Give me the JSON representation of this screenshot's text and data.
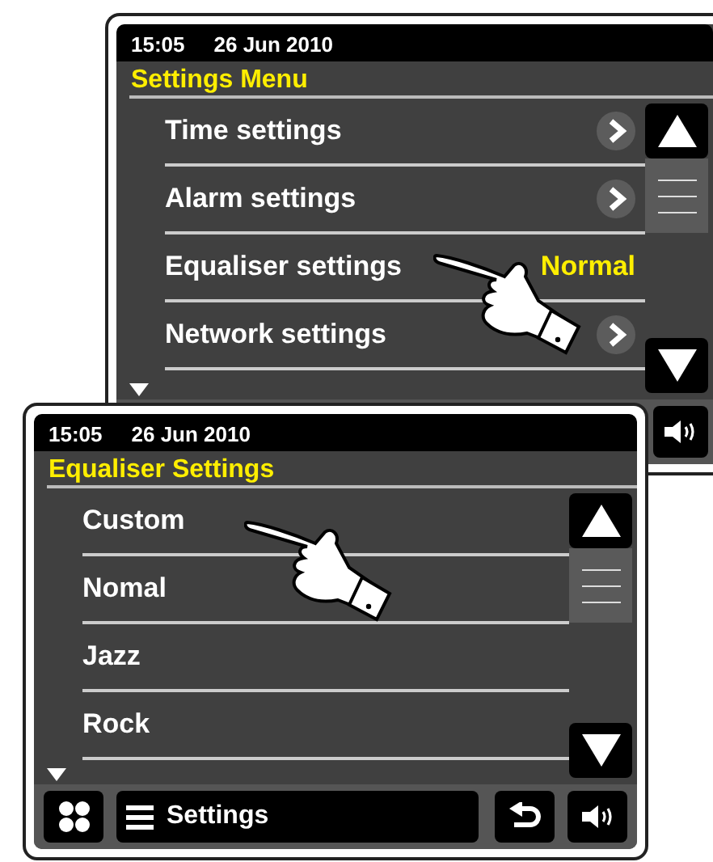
{
  "screens": [
    {
      "time": "15:05",
      "date": "26 Jun 2010",
      "title": "Settings Menu",
      "items": [
        {
          "label": "Time settings",
          "kind": "arrow"
        },
        {
          "label": "Alarm settings",
          "kind": "arrow"
        },
        {
          "label": "Equaliser settings",
          "kind": "value",
          "value": "Normal"
        },
        {
          "label": "Network settings",
          "kind": "arrow"
        }
      ],
      "more_below": true,
      "footer": [
        {
          "kind": "volume"
        }
      ]
    },
    {
      "time": "15:05",
      "date": "26 Jun 2010",
      "title": "Equaliser Settings",
      "items": [
        {
          "label": "Custom",
          "kind": "plain"
        },
        {
          "label": "Nomal",
          "kind": "plain"
        },
        {
          "label": "Jazz",
          "kind": "plain"
        },
        {
          "label": "Rock",
          "kind": "plain"
        }
      ],
      "more_below": true,
      "footer": [
        {
          "kind": "home"
        },
        {
          "kind": "menu",
          "label": "Settings"
        },
        {
          "kind": "back"
        },
        {
          "kind": "volume"
        }
      ]
    }
  ]
}
